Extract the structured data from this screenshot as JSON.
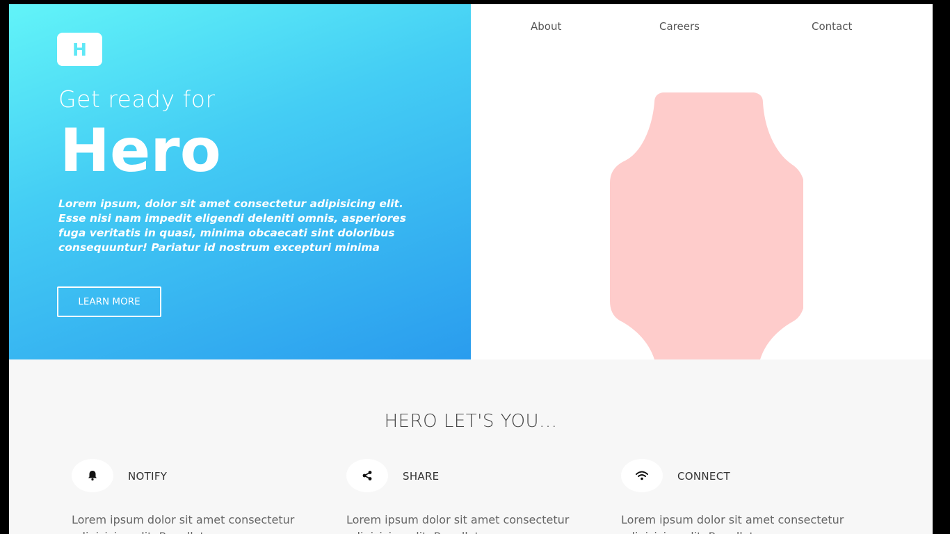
{
  "brand": {
    "logo_letter": "H"
  },
  "nav": {
    "items": [
      {
        "label": "About"
      },
      {
        "label": "Careers"
      },
      {
        "label": "Contact"
      }
    ]
  },
  "hero": {
    "subtitle": "Get ready for",
    "title": "Hero",
    "text": "Lorem ipsum, dolor sit amet consectetur adipisicing elit. Esse nisi nam impedit eligendi deleniti omnis, asperiores fuga veritatis in quasi, minima obcaecati sint doloribus consequuntur! Pariatur id nostrum excepturi minima",
    "cta_label": "LEARN MORE",
    "gradient_start": "#62f4f8",
    "gradient_end": "#2a9cee",
    "watch_color": "#fecccb",
    "watch_icon": "smartwatch-illustration"
  },
  "features": {
    "title": "HERO LET'S YOU...",
    "items": [
      {
        "icon": "bell-icon",
        "label": "NOTIFY",
        "text": "Lorem ipsum dolor sit amet consectetur adipisicing elit. Repellat"
      },
      {
        "icon": "share-icon",
        "label": "SHARE",
        "text": "Lorem ipsum dolor sit amet consectetur adipisicing elit. Repellat"
      },
      {
        "icon": "wifi-icon",
        "label": "CONNECT",
        "text": "Lorem ipsum dolor sit amet consectetur adipisicing elit. Repellat"
      }
    ]
  }
}
